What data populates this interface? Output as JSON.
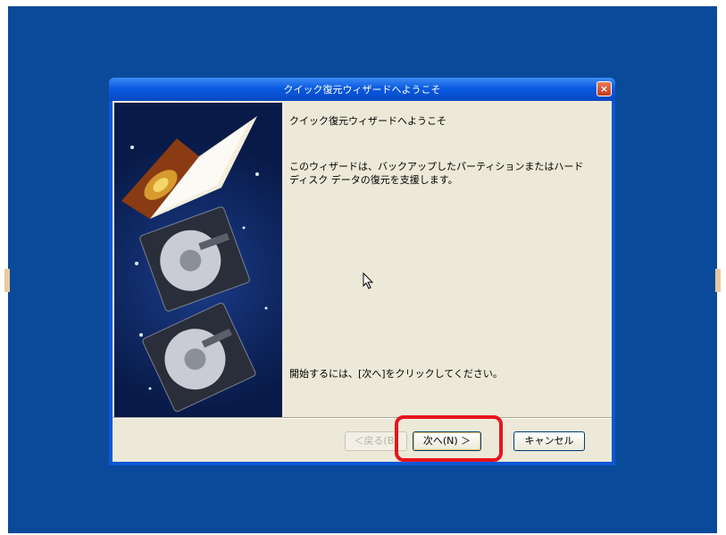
{
  "window": {
    "title": "クイック復元ウィザードへようこそ",
    "close_glyph": "×"
  },
  "content": {
    "heading": "クイック復元ウィザードへようこそ",
    "description": "このウィザードは、バックアップしたパーティションまたはハードディスク データの復元を支援します。",
    "instruction": "開始するには、[次へ]をクリックしてください。"
  },
  "buttons": {
    "back": "＜戻る(B)",
    "next": "次へ(N) ＞",
    "cancel": "キャンセル"
  },
  "colors": {
    "desktop": "#0a4a9a",
    "highlight": "#e8141a",
    "dialog_bg": "#ece9d8"
  },
  "icons": [
    "close-icon",
    "book-hard-disk-graphic",
    "mouse-cursor-icon"
  ]
}
